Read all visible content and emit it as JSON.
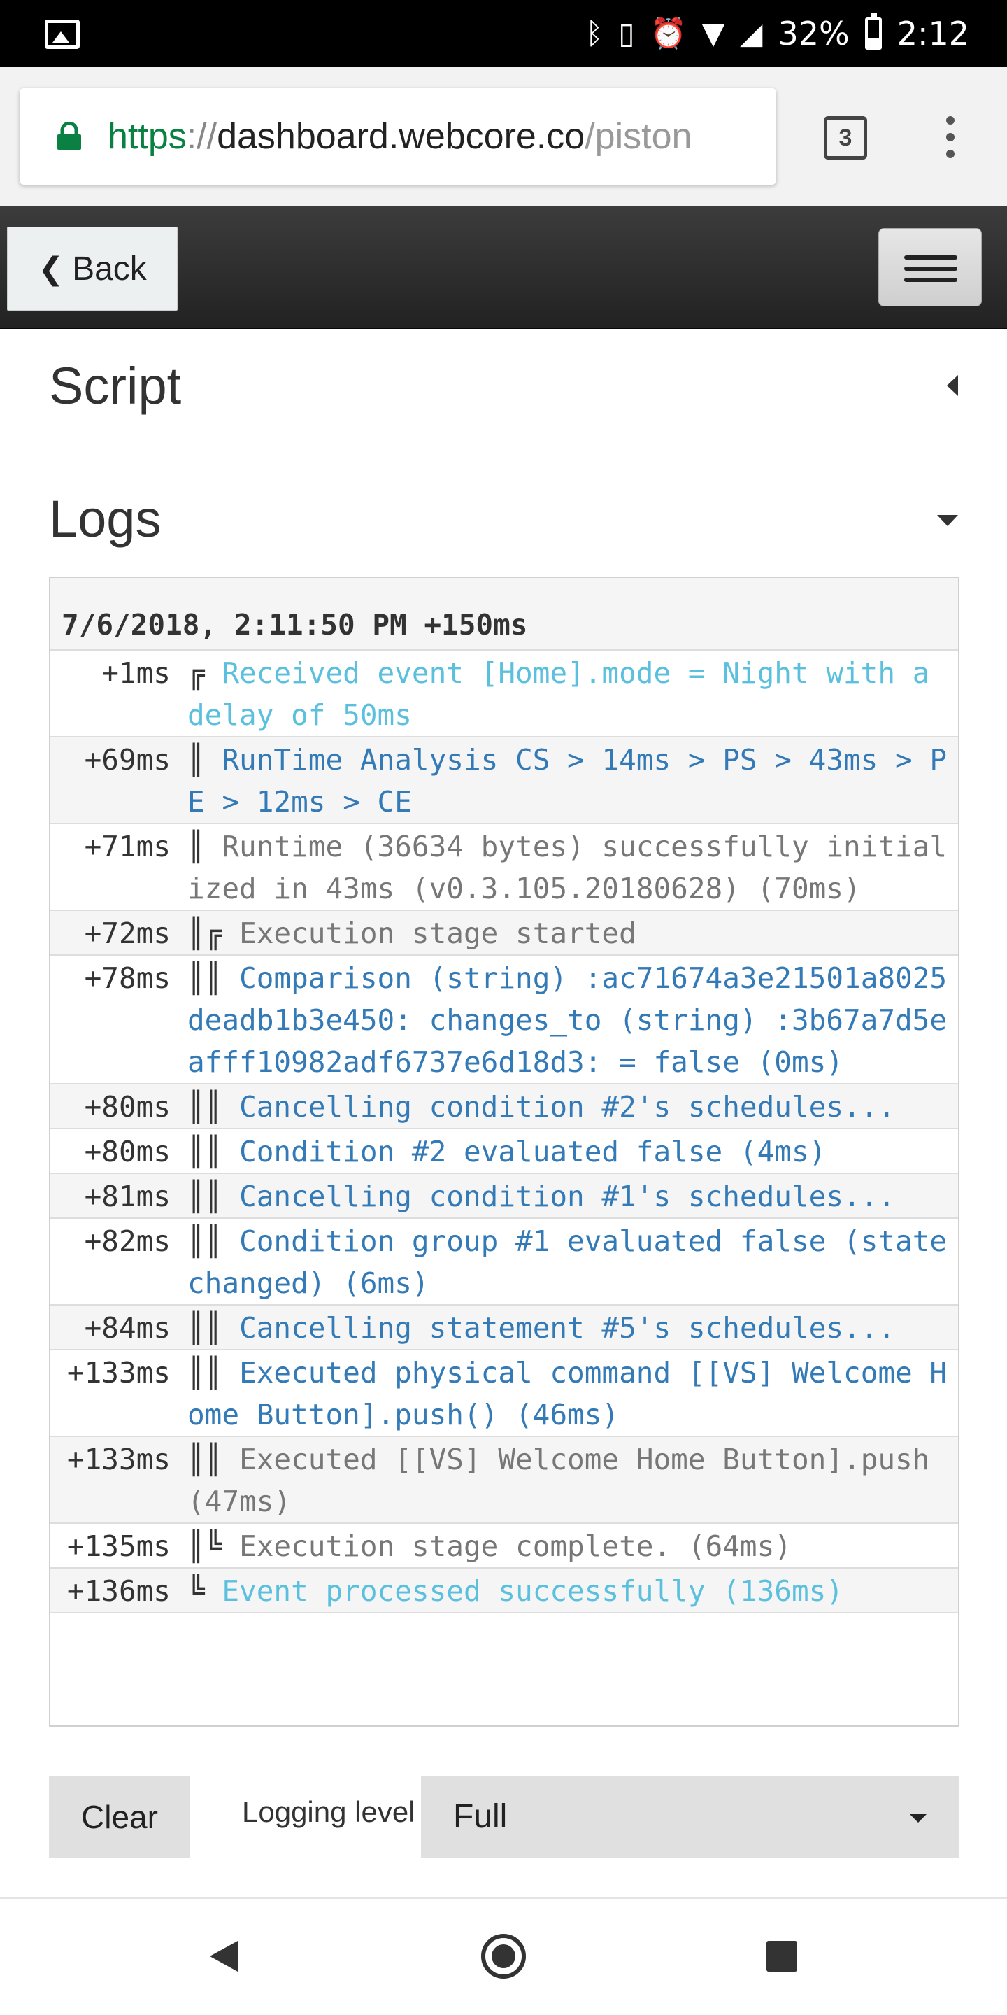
{
  "status_bar": {
    "battery_percent": "32%",
    "time": "2:12",
    "icons": [
      "image-icon",
      "bluetooth-icon",
      "vibrate-icon",
      "alarm-icon",
      "wifi-icon",
      "signal-icon",
      "battery-icon"
    ]
  },
  "browser": {
    "url_protocol": "https",
    "url_separator": "://",
    "url_host": "dashboard.webcore.co",
    "url_path": "/piston",
    "tab_count": "3"
  },
  "navbar": {
    "back_label": "Back"
  },
  "script_panel": {
    "title": "Script"
  },
  "logs_panel": {
    "title": "Logs",
    "header": "7/6/2018, 2:11:50 PM +150ms",
    "entries": [
      {
        "time": "+1ms",
        "prefix": "╔",
        "message": "Received event [Home].mode = Night with a delay of 50ms",
        "level": "info"
      },
      {
        "time": "+69ms",
        "prefix": "║",
        "message": "RunTime Analysis CS > 14ms > PS > 43ms > PE > 12ms > CE",
        "level": "debug"
      },
      {
        "time": "+71ms",
        "prefix": "║",
        "message": "Runtime (36634 bytes) successfully initialized in 43ms (v0.3.105.20180628) (70ms)",
        "level": "trace"
      },
      {
        "time": "+72ms",
        "prefix": "║╔",
        "message": "Execution stage started",
        "level": "trace"
      },
      {
        "time": "+78ms",
        "prefix": "║║",
        "message": "Comparison (string) :ac71674a3e21501a8025deadb1b3e450: changes_to (string) :3b67a7d5eafff10982adf6737e6d18d3: = false (0ms)",
        "level": "debug"
      },
      {
        "time": "+80ms",
        "prefix": "║║",
        "message": "Cancelling condition #2's schedules...",
        "level": "debug"
      },
      {
        "time": "+80ms",
        "prefix": "║║",
        "message": "Condition #2 evaluated false (4ms)",
        "level": "debug"
      },
      {
        "time": "+81ms",
        "prefix": "║║",
        "message": "Cancelling condition #1's schedules...",
        "level": "debug"
      },
      {
        "time": "+82ms",
        "prefix": "║║",
        "message": "Condition group #1 evaluated false (state changed) (6ms)",
        "level": "debug"
      },
      {
        "time": "+84ms",
        "prefix": "║║",
        "message": "Cancelling statement #5's schedules...",
        "level": "debug"
      },
      {
        "time": "+133ms",
        "prefix": "║║",
        "message": "Executed physical command [[VS] Welcome Home Button].push() (46ms)",
        "level": "debug"
      },
      {
        "time": "+133ms",
        "prefix": "║║",
        "message": "Executed [[VS] Welcome Home Button].push (47ms)",
        "level": "trace"
      },
      {
        "time": "+135ms",
        "prefix": "║╚",
        "message": "Execution stage complete. (64ms)",
        "level": "trace"
      },
      {
        "time": "+136ms",
        "prefix": "╚",
        "message": "Event processed successfully (136ms)",
        "level": "info"
      }
    ]
  },
  "controls": {
    "clear_label": "Clear",
    "logging_level_label": "Logging level",
    "logging_level_value": "Full"
  },
  "colors": {
    "info": "#5bc0de",
    "debug": "#337ab7",
    "trace": "#777777",
    "url_green": "#0b8043"
  }
}
